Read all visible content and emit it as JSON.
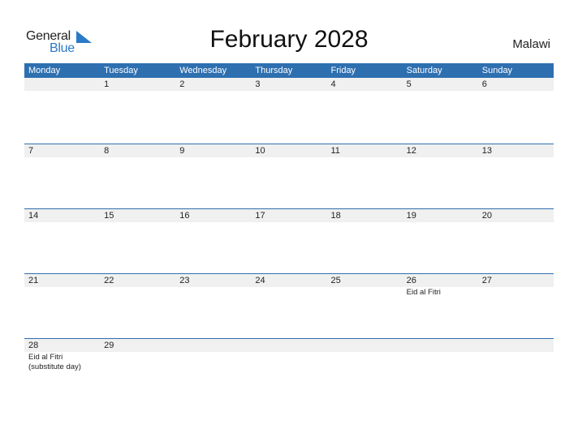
{
  "logo": {
    "word1": "General",
    "word2": "Blue"
  },
  "title": "February 2028",
  "country": "Malawi",
  "colors": {
    "header_bg": "#2e6fb0",
    "logo_blue": "#2a7ac7",
    "date_strip": "#f0f0f0"
  },
  "weekdays": [
    "Monday",
    "Tuesday",
    "Wednesday",
    "Thursday",
    "Friday",
    "Saturday",
    "Sunday"
  ],
  "weeks": [
    [
      {
        "date": ""
      },
      {
        "date": "1"
      },
      {
        "date": "2"
      },
      {
        "date": "3"
      },
      {
        "date": "4"
      },
      {
        "date": "5"
      },
      {
        "date": "6"
      }
    ],
    [
      {
        "date": "7"
      },
      {
        "date": "8"
      },
      {
        "date": "9"
      },
      {
        "date": "10"
      },
      {
        "date": "11"
      },
      {
        "date": "12"
      },
      {
        "date": "13"
      }
    ],
    [
      {
        "date": "14"
      },
      {
        "date": "15"
      },
      {
        "date": "16"
      },
      {
        "date": "17"
      },
      {
        "date": "18"
      },
      {
        "date": "19"
      },
      {
        "date": "20"
      }
    ],
    [
      {
        "date": "21"
      },
      {
        "date": "22"
      },
      {
        "date": "23"
      },
      {
        "date": "24"
      },
      {
        "date": "25"
      },
      {
        "date": "26",
        "event": "Eid al Fitri"
      },
      {
        "date": "27"
      }
    ],
    [
      {
        "date": "28",
        "event": "Eid al Fitri (substitute day)"
      },
      {
        "date": "29"
      },
      {
        "date": ""
      },
      {
        "date": ""
      },
      {
        "date": ""
      },
      {
        "date": ""
      },
      {
        "date": ""
      }
    ]
  ]
}
